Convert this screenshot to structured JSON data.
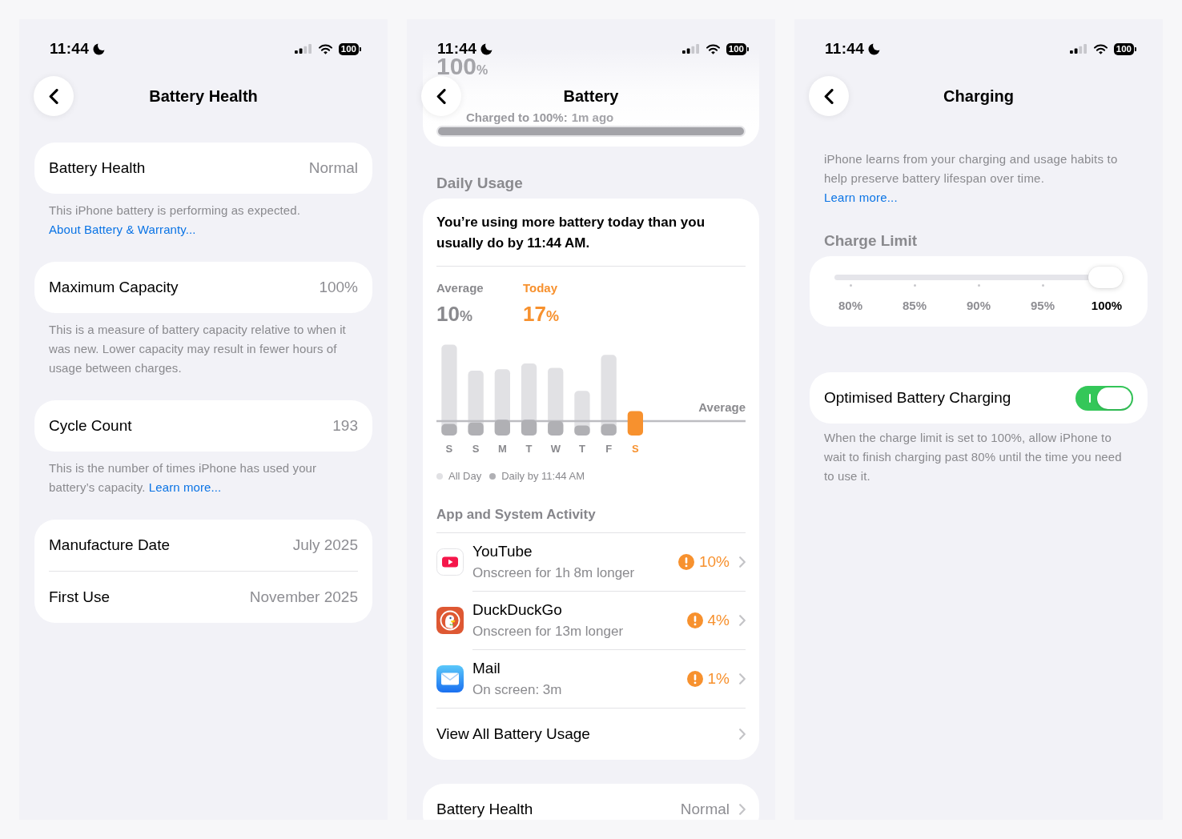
{
  "battery_health_screen": {
    "status_bar": {
      "time": "11:44",
      "battery": "100"
    },
    "title": "Battery Health",
    "groups": [
      {
        "rows": [
          {
            "label": "Battery Health",
            "value": "Normal"
          }
        ],
        "footer": {
          "text": "This iPhone battery is performing as expected.",
          "link": "About Battery & Warranty..."
        }
      },
      {
        "rows": [
          {
            "label": "Maximum Capacity",
            "value": "100%"
          }
        ],
        "footer": {
          "text": "This is a measure of battery capacity relative to when it was new. Lower capacity may result in fewer hours of usage between charges."
        }
      },
      {
        "rows": [
          {
            "label": "Cycle Count",
            "value": "193"
          }
        ],
        "footer": {
          "text": "This is the number of times iPhone has used your battery’s capacity.",
          "link": "Learn more..."
        }
      },
      {
        "rows": [
          {
            "label": "Manufacture Date",
            "value": "July 2025"
          },
          {
            "label": "First Use",
            "value": "November 2025"
          }
        ]
      }
    ]
  },
  "battery_screen": {
    "status_bar": {
      "time": "11:44",
      "battery": "100"
    },
    "title": "Battery",
    "charge_summary": {
      "value": "100",
      "unit": "%",
      "last_charged": "Charged to 100%:",
      "last_charged_time": "1m ago",
      "level": 1
    },
    "daily_usage": {
      "heading": "Daily Usage",
      "message": "You’re using more battery today than you usually do by 11:44 AM.",
      "stats": [
        {
          "label": "Average",
          "value": "10",
          "unit": "%",
          "color": "#8a8a8e"
        },
        {
          "label": "Today",
          "value": "17",
          "unit": "%",
          "color": "#f7912e"
        }
      ],
      "chart": {
        "days": [
          {
            "label": "S",
            "today": false
          },
          {
            "label": "S",
            "today": false
          },
          {
            "label": "M",
            "today": false
          },
          {
            "label": "T",
            "today": false
          },
          {
            "label": "W",
            "today": false
          },
          {
            "label": "T",
            "today": false
          },
          {
            "label": "F",
            "today": false
          },
          {
            "label": "S",
            "today": true
          }
        ],
        "reference_label": "Average",
        "legend": [
          {
            "label": "All Day",
            "color": "#e1e1e4"
          },
          {
            "label": "Daily by 11:44 AM",
            "color": "#b0b0b4"
          }
        ]
      },
      "activity_heading": "App and System Activity",
      "apps": [
        {
          "kind": "video",
          "name": "YouTube",
          "detail": "Onscreen for 1h 8m longer",
          "share": "10%",
          "alert": true
        },
        {
          "kind": "duck",
          "name": "DuckDuckGo",
          "detail": "Onscreen for 13m longer",
          "share": "4%",
          "alert": true
        },
        {
          "kind": "mail",
          "name": "Mail",
          "detail": "On screen: 3m",
          "share": "1%",
          "alert": true
        }
      ],
      "view_all": "View All Battery Usage"
    },
    "battery_health_row": {
      "label": "Battery Health",
      "value": "Normal"
    }
  },
  "charging_screen": {
    "status_bar": {
      "time": "11:44",
      "battery": "100"
    },
    "title": "Charging",
    "intro": {
      "text": "iPhone learns from your charging and usage habits to help preserve battery lifespan over time.",
      "link": "Learn more..."
    },
    "charge_limit": {
      "heading": "Charge Limit",
      "level": 1,
      "options": [
        {
          "label": "80%",
          "selected": false
        },
        {
          "label": "85%",
          "selected": false
        },
        {
          "label": "90%",
          "selected": false
        },
        {
          "label": "95%",
          "selected": false
        },
        {
          "label": "100%",
          "selected": true
        }
      ]
    },
    "optimised_charging": {
      "label": "Optimised Battery Charging",
      "on": true,
      "footer": "When the charge limit is set to 100%, allow iPhone to wait to finish charging past 80% until the time you need to use it."
    }
  }
}
